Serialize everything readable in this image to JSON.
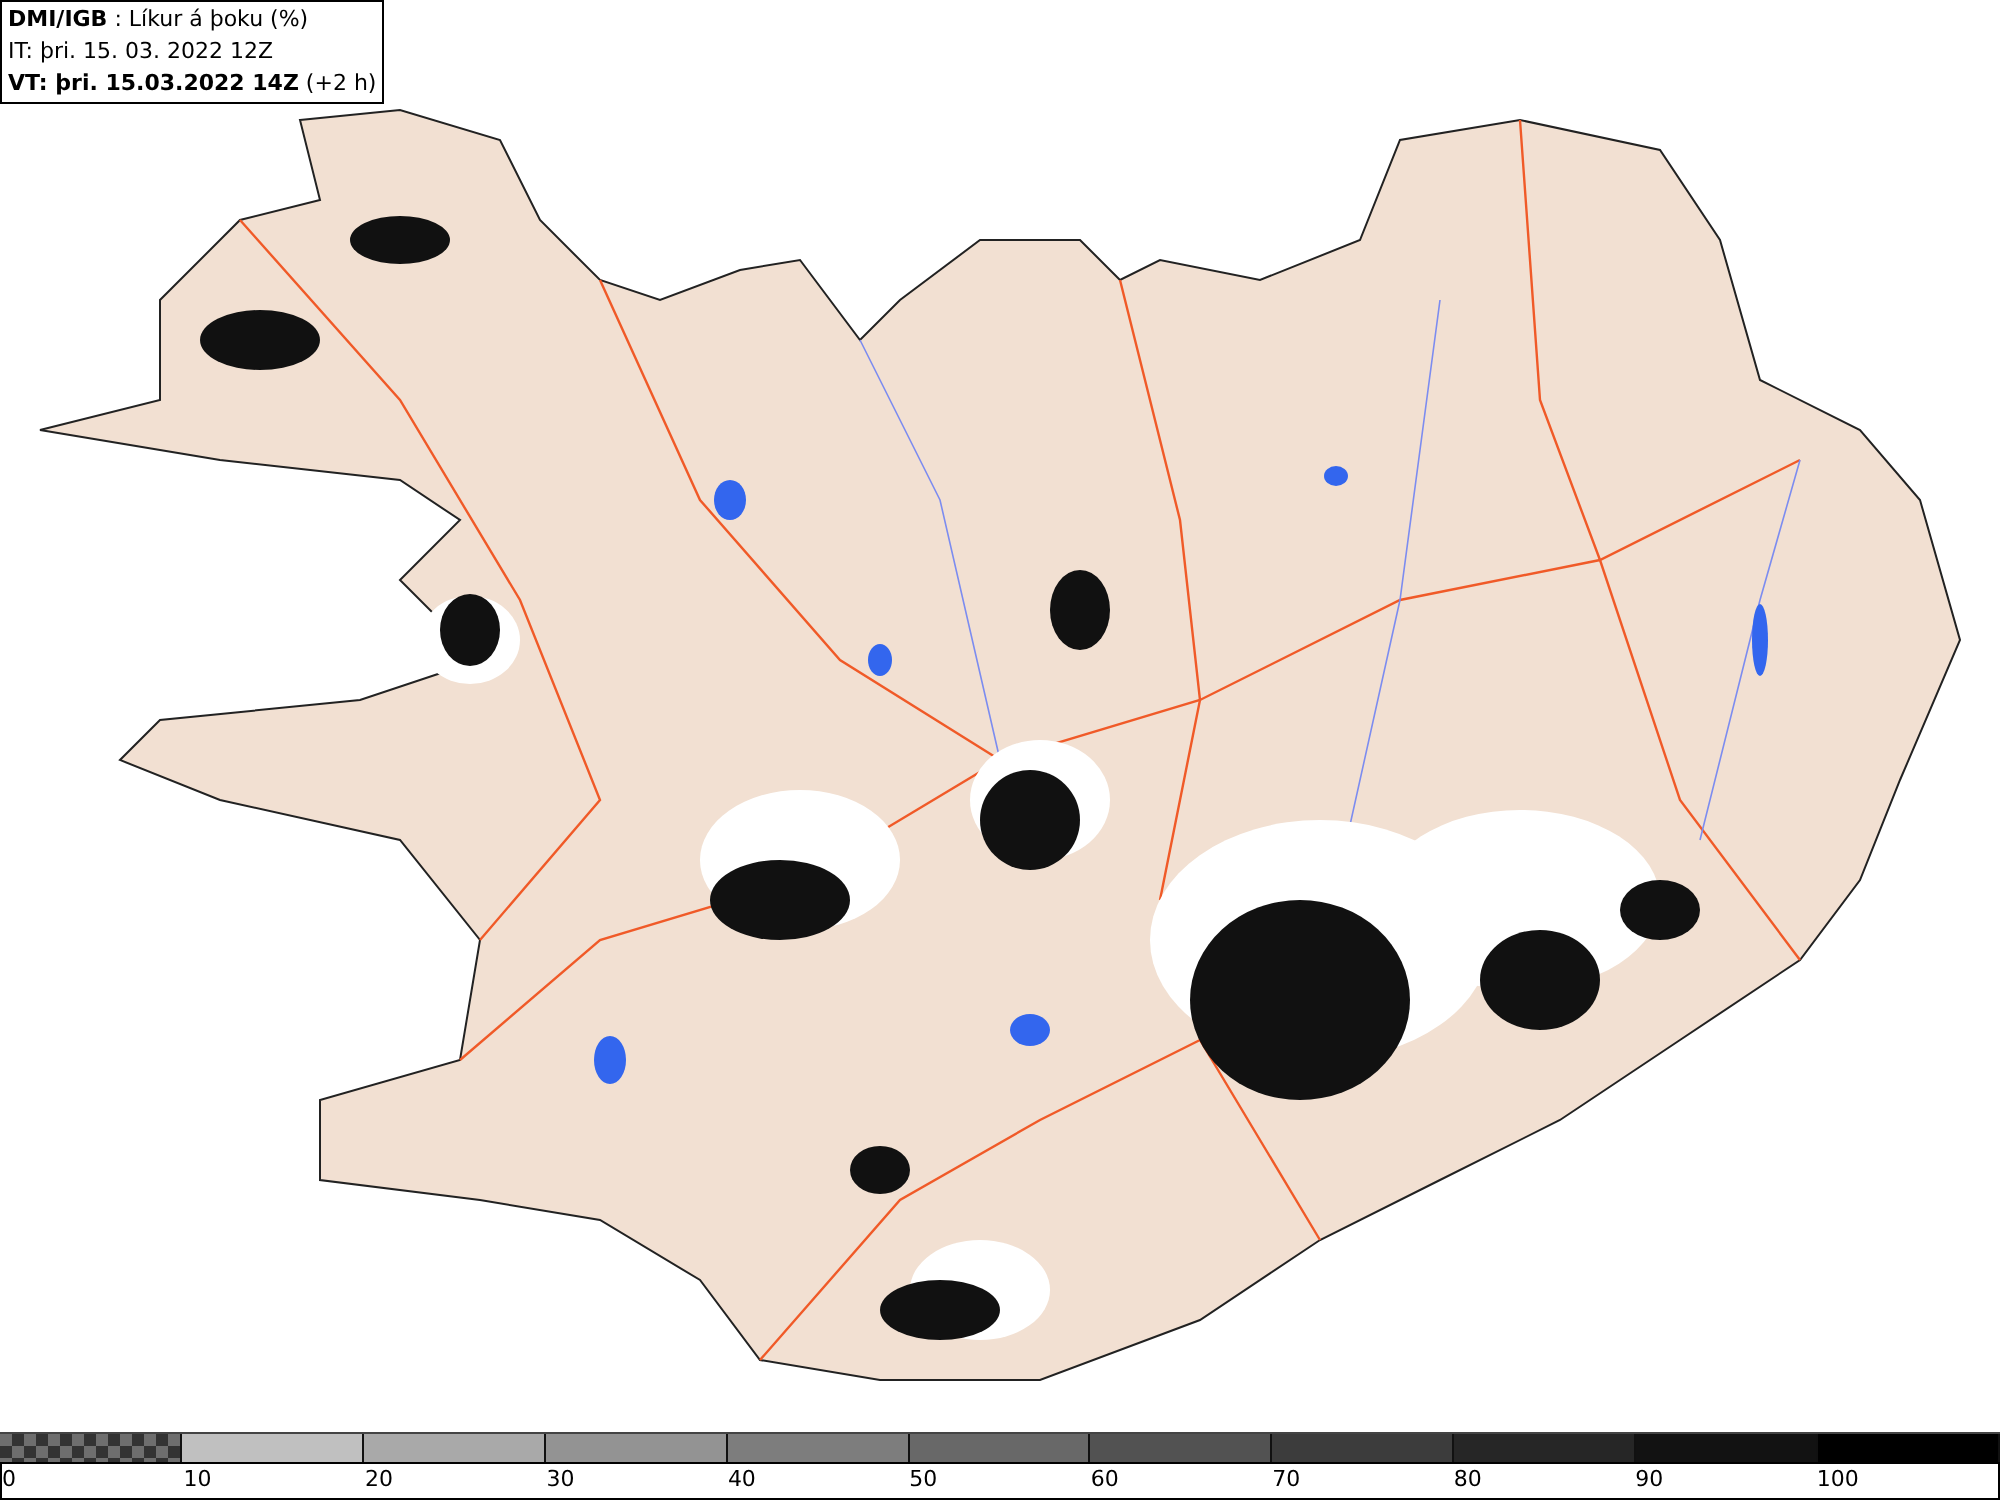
{
  "header": {
    "line_1": "**DMI/IGB** : Líkur á þoku (%)",
    "line_2": "IT: þri. 15. 03. 2022 12Z",
    "line_3": "**VT: þri. 15.03.2022 14Z** (+2 h)"
  },
  "legend": {
    "segments": [
      {
        "kind": "checker"
      },
      {
        "kind": "solid",
        "color": "#c0c0c0"
      },
      {
        "kind": "solid",
        "color": "#a9a9a9"
      },
      {
        "kind": "solid",
        "color": "#939393"
      },
      {
        "kind": "solid",
        "color": "#7d7d7d"
      },
      {
        "kind": "solid",
        "color": "#686868"
      },
      {
        "kind": "solid",
        "color": "#525252"
      },
      {
        "kind": "solid",
        "color": "#3c3c3c"
      },
      {
        "kind": "solid",
        "color": "#262626"
      },
      {
        "kind": "solid",
        "color": "#121212"
      },
      {
        "kind": "solid",
        "color": "#000000"
      }
    ],
    "labels": [
      "0",
      "10",
      "20",
      "30",
      "40",
      "50",
      "60",
      "70",
      "80",
      "90",
      "100"
    ]
  }
}
